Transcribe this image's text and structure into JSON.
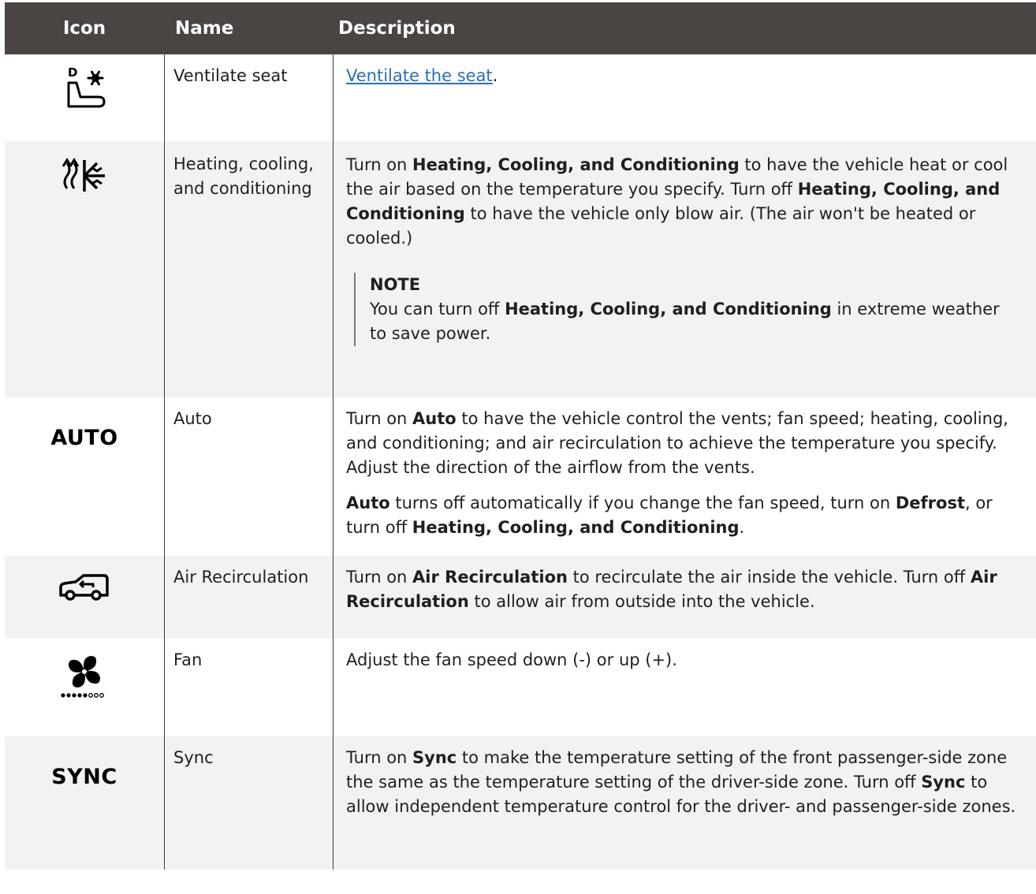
{
  "table": {
    "headers": {
      "icon": "Icon",
      "name": "Name",
      "description": "Description"
    },
    "rows": [
      {
        "icon": "ventilate-seat-icon",
        "name": "Ventilate seat",
        "link_text": "Ventilate the seat",
        "link_suffix": "."
      },
      {
        "icon": "hvac-heat-cool-icon",
        "name": "Heating, cooling, and conditioning",
        "p1": [
          "Turn on ",
          "Heating, Cooling, and Conditioning",
          " to have the vehicle heat or cool the air based on the temperature you specify. Turn off ",
          "Heating, Cooling, and Conditioning",
          " to have the vehicle only blow air. (The air won't be heated or cooled.)"
        ],
        "note_title": "NOTE",
        "note": [
          "You can turn off ",
          "Heating, Cooling, and Conditioning",
          " in extreme weather to save power."
        ]
      },
      {
        "icon_text": "AUTO",
        "name": "Auto",
        "p1": [
          "Turn on ",
          "Auto",
          " to have the vehicle control the vents; fan speed; heating, cooling, and conditioning; and air recirculation to achieve the temperature you specify. Adjust the direction of the airflow from the vents."
        ],
        "p2": [
          "Auto",
          " turns off automatically if you change the fan speed, turn on ",
          "Defrost",
          ", or turn off ",
          "Heating, Cooling, and Conditioning",
          "."
        ]
      },
      {
        "icon": "air-recirculation-icon",
        "name": "Air Recirculation",
        "p1": [
          "Turn on ",
          "Air Recirculation",
          " to recirculate the air inside the vehicle. Turn off ",
          "Air Recirculation",
          " to allow air from outside into the vehicle."
        ]
      },
      {
        "icon": "fan-icon",
        "name": "Fan",
        "p1": [
          "Adjust the fan speed down (-) or up (+)."
        ]
      },
      {
        "icon_text": "SYNC",
        "name": "Sync",
        "p1": [
          "Turn on ",
          "Sync",
          " to make the temperature setting of the front passenger-side zone the same as the temperature setting of the driver-side zone. Turn off ",
          "Sync",
          " to allow independent temperature control for the driver- and passenger-side zones."
        ]
      }
    ]
  }
}
